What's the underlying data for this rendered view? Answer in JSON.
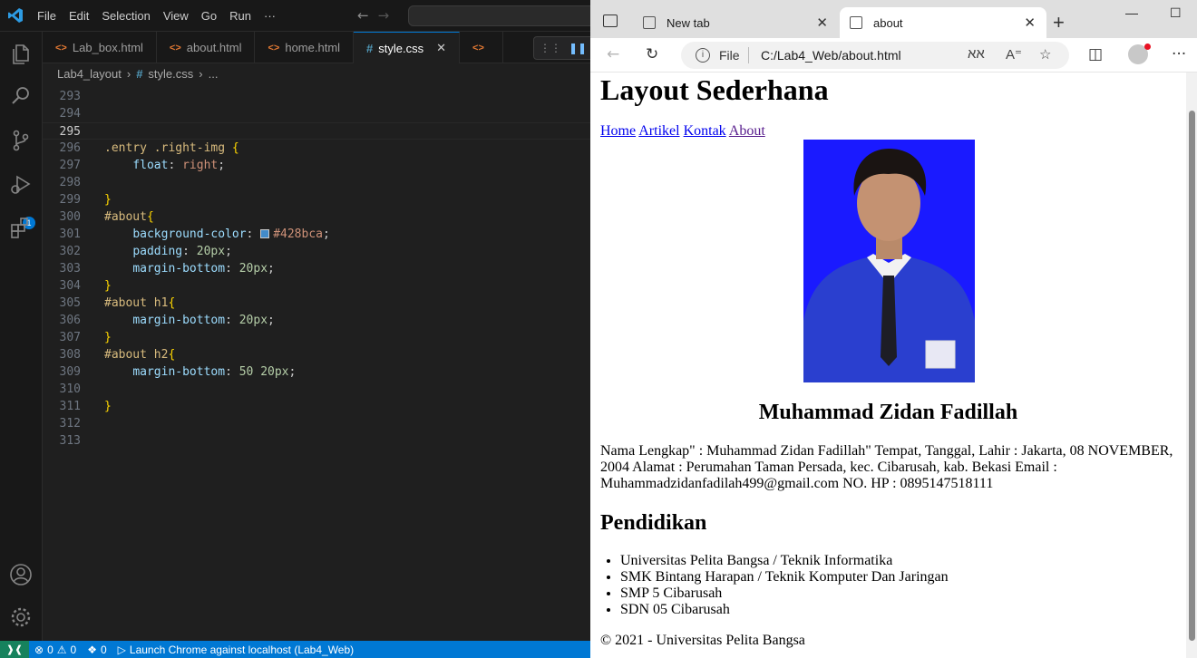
{
  "vscode": {
    "menu": [
      "File",
      "Edit",
      "Selection",
      "View",
      "Go",
      "Run",
      "···"
    ],
    "tabs": [
      {
        "label": "Lab_box.html",
        "icon": "html-file-icon"
      },
      {
        "label": "about.html",
        "icon": "html-file-icon"
      },
      {
        "label": "home.html",
        "icon": "html-file-icon"
      },
      {
        "label": "style.css",
        "icon": "css-file-icon",
        "active": true
      }
    ],
    "breadcrumb": {
      "folder": "Lab4_layout",
      "file": "style.css",
      "more": "..."
    },
    "lines": [
      {
        "n": "293"
      },
      {
        "n": "294"
      },
      {
        "n": "295"
      },
      {
        "n": "296"
      },
      {
        "n": "297"
      },
      {
        "n": "298"
      },
      {
        "n": "299"
      },
      {
        "n": "300"
      },
      {
        "n": "301"
      },
      {
        "n": "302"
      },
      {
        "n": "303"
      },
      {
        "n": "304"
      },
      {
        "n": "305"
      },
      {
        "n": "306"
      },
      {
        "n": "307"
      },
      {
        "n": "308"
      },
      {
        "n": "309"
      },
      {
        "n": "310"
      },
      {
        "n": "311"
      },
      {
        "n": "312"
      },
      {
        "n": "313"
      }
    ],
    "code": {
      "l296": ".entry .right-img",
      "l297_prop": "float",
      "l297_val": "right",
      "l300": "#about",
      "l301_prop": "background-color",
      "l301_val": "#428bca",
      "l302_prop": "padding",
      "l302_val": "20px",
      "l303_prop": "margin-bottom",
      "l303_val": "20px",
      "l305": "#about h1",
      "l306_prop": "margin-bottom",
      "l306_val": "20px",
      "l308": "#about h2",
      "l309_prop": "margin-bottom",
      "l309_val": "50 20px"
    },
    "swatch_color": "#428bca",
    "statusbar": {
      "errors": "0",
      "warnings": "0",
      "ports": "0",
      "launch": "Launch Chrome against localhost (Lab4_Web)"
    },
    "activity_badge": "1"
  },
  "browser": {
    "tabs": [
      {
        "label": "New tab",
        "active": false
      },
      {
        "label": "about",
        "active": true
      }
    ],
    "address": {
      "scheme": "File",
      "url": "C:/Lab4_Web/about.html"
    },
    "page": {
      "title": "Layout Sederhana",
      "nav": [
        "Home",
        "Artikel",
        "Kontak",
        "About"
      ],
      "name": "Muhammad Zidan Fadillah",
      "bio": "Nama Lengkap\" : Muhammad Zidan Fadillah\" Tempat, Tanggal, Lahir : Jakarta, 08 NOVEMBER, 2004 Alamat : Perumahan Taman Persada, kec. Cibarusah, kab. Bekasi Email : Muhammadzidanfadilah499@gmail.com NO. HP : 0895147518111",
      "edu_title": "Pendidikan",
      "education": [
        "Universitas Pelita Bangsa / Teknik Informatika",
        "SMK Bintang Harapan / Teknik Komputer Dan Jaringan",
        "SMP 5 Cibarusah",
        "SDN 05 Cibarusah"
      ],
      "footer": "© 2021 - Universitas Pelita Bangsa"
    }
  }
}
